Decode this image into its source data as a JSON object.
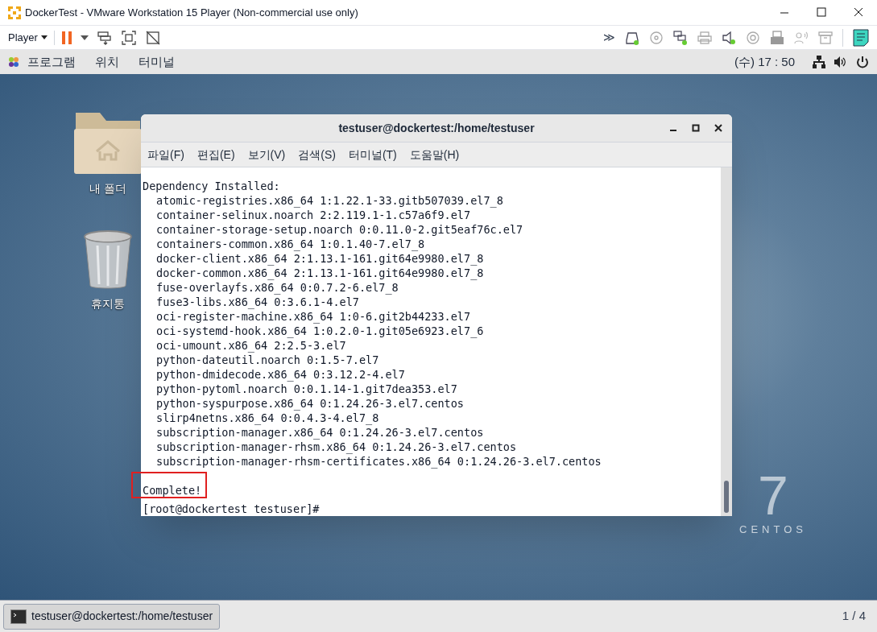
{
  "window": {
    "title": "DockerTest - VMware Workstation 15 Player (Non-commercial use only)"
  },
  "toolbar": {
    "player_menu": "Player",
    "overflow": "≫"
  },
  "gnome_bar": {
    "menus": [
      "프로그램",
      "위치",
      "터미널"
    ],
    "clock": "(수) 17 : 50"
  },
  "desktop_icons": [
    {
      "kind": "folder",
      "label": "내 폴더"
    },
    {
      "kind": "trash",
      "label": "휴지통"
    }
  ],
  "terminal": {
    "title": "testuser@dockertest:/home/testuser",
    "menus": [
      "파일(F)",
      "편집(E)",
      "보기(V)",
      "검색(S)",
      "터미널(T)",
      "도움말(H)"
    ],
    "heading": "Dependency Installed:",
    "packages": [
      "atomic-registries.x86_64 1:1.22.1-33.gitb507039.el7_8",
      "container-selinux.noarch 2:2.119.1-1.c57a6f9.el7",
      "container-storage-setup.noarch 0:0.11.0-2.git5eaf76c.el7",
      "containers-common.x86_64 1:0.1.40-7.el7_8",
      "docker-client.x86_64 2:1.13.1-161.git64e9980.el7_8",
      "docker-common.x86_64 2:1.13.1-161.git64e9980.el7_8",
      "fuse-overlayfs.x86_64 0:0.7.2-6.el7_8",
      "fuse3-libs.x86_64 0:3.6.1-4.el7",
      "oci-register-machine.x86_64 1:0-6.git2b44233.el7",
      "oci-systemd-hook.x86_64 1:0.2.0-1.git05e6923.el7_6",
      "oci-umount.x86_64 2:2.5-3.el7",
      "python-dateutil.noarch 0:1.5-7.el7",
      "python-dmidecode.x86_64 0:3.12.2-4.el7",
      "python-pytoml.noarch 0:0.1.14-1.git7dea353.el7",
      "python-syspurpose.x86_64 0:1.24.26-3.el7.centos",
      "slirp4netns.x86_64 0:0.4.3-4.el7_8",
      "subscription-manager.x86_64 0:1.24.26-3.el7.centos",
      "subscription-manager-rhsm.x86_64 0:1.24.26-3.el7.centos",
      "subscription-manager-rhsm-certificates.x86_64 0:1.24.26-3.el7.centos"
    ],
    "complete": "Complete!",
    "prompt": "[root@dockertest testuser]#"
  },
  "centos_logo": {
    "number": "7",
    "wordmark": "CENTOS"
  },
  "taskbar": {
    "window_button": "testuser@dockertest:/home/testuser",
    "workspace": "1 / 4"
  }
}
